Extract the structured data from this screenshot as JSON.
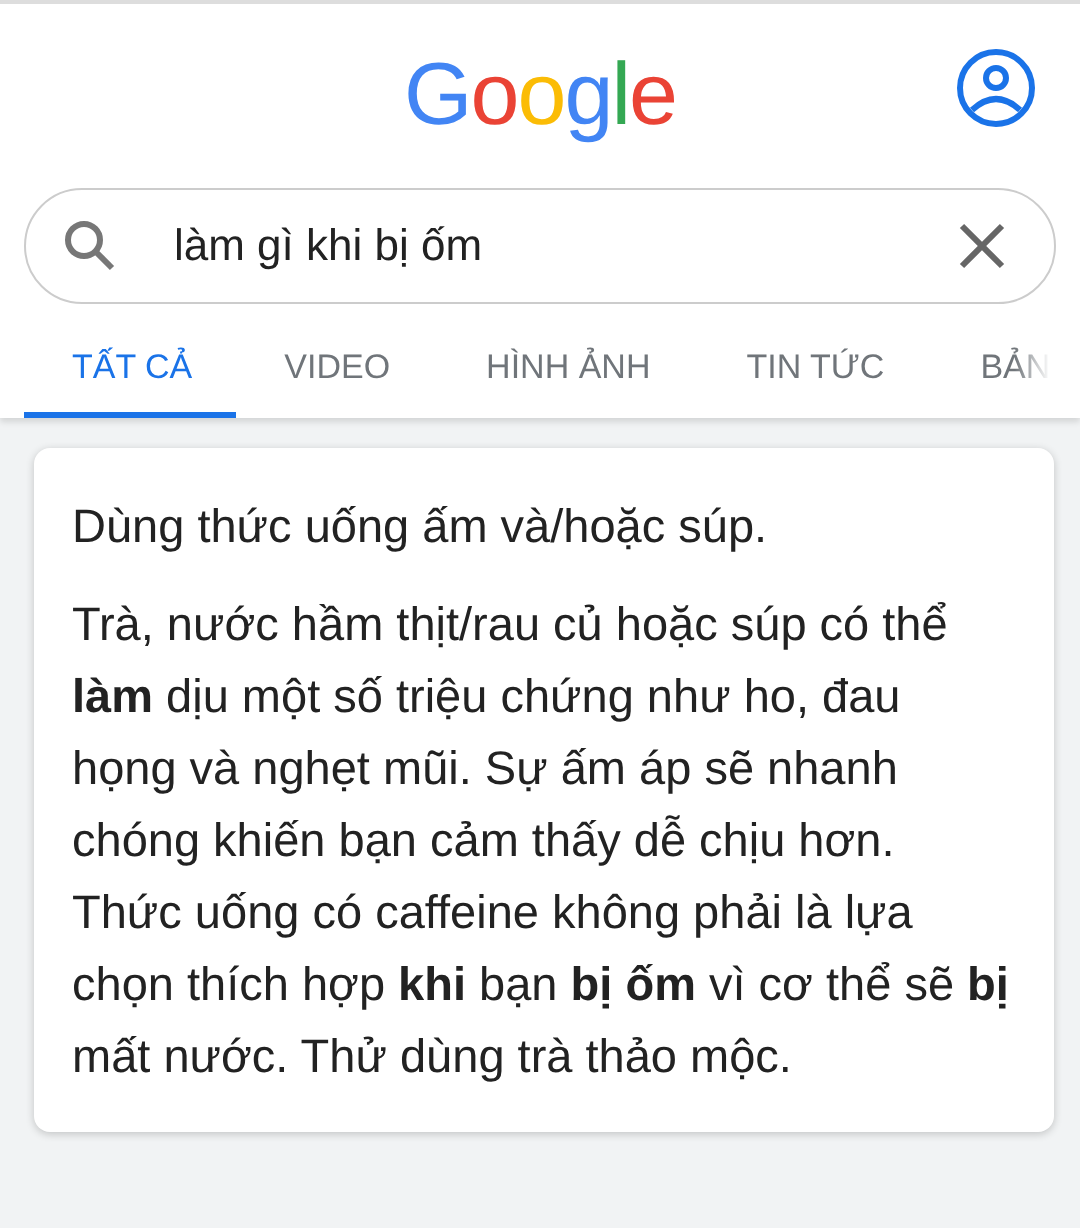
{
  "logo": "Google",
  "search": {
    "value": "làm gì khi bị ốm"
  },
  "tabs": [
    {
      "label": "TẤT CẢ",
      "selected": true
    },
    {
      "label": "VIDEO",
      "selected": false
    },
    {
      "label": "HÌNH ẢNH",
      "selected": false
    },
    {
      "label": "TIN TỨC",
      "selected": false
    },
    {
      "label": "BẢN",
      "selected": false
    }
  ],
  "card": {
    "heading": "Dùng thức uống ấm và/hoặc súp.",
    "text": "Trà, nước hầm thịt/rau củ hoặc súp có thể **làm** dịu một số triệu chứng như ho, đau họng và nghẹt mũi. Sự ấm áp sẽ nhanh chóng khiến bạn cảm thấy dễ chịu hơn. Thức uống có caffeine không phải là lựa chọn thích hợp **khi** bạn **bị** **ốm** vì cơ thể sẽ **bị** mất nước. Thử dùng trà thảo mộc."
  }
}
